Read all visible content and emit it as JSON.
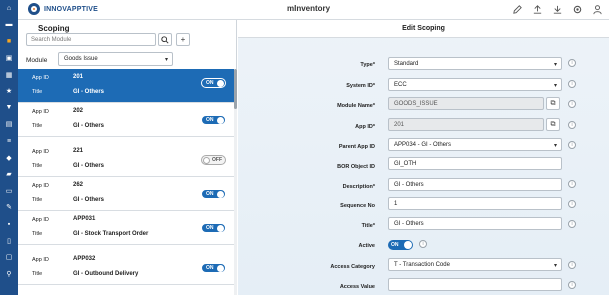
{
  "brand": {
    "name": "INNOVAPPTIVE"
  },
  "app_title": "mInventory",
  "top_icons": [
    "pencil-icon",
    "upload-icon",
    "download-icon",
    "gear-icon",
    "user-icon"
  ],
  "rail_icons": [
    "home-icon",
    "folder-icon",
    "doc-icon",
    "grid-icon",
    "star-icon",
    "filter-icon",
    "calc-icon",
    "list-icon",
    "tag-icon",
    "truck-icon",
    "inbox-icon",
    "edit-icon",
    "box-icon",
    "page-icon",
    "upload-icon",
    "monitor-icon",
    "link-icon"
  ],
  "left": {
    "title": "Scoping",
    "search_placeholder": "Search Module",
    "module_label": "Module",
    "module_value": "Goods Issue",
    "rows": [
      {
        "label1": "App ID",
        "value1": "201",
        "label2": "Title",
        "value2": "GI - Others",
        "toggle": "ON",
        "selected": true
      },
      {
        "label1": "App ID",
        "value1": "202",
        "label2": "Title",
        "value2": "GI - Others",
        "toggle": "ON",
        "selected": false
      },
      {
        "label1": "App ID",
        "value1": "221",
        "label2": "Title",
        "value2": "GI - Others",
        "toggle": "OFF",
        "selected": false
      },
      {
        "label1": "App ID",
        "value1": "262",
        "label2": "Title",
        "value2": "GI - Others",
        "toggle": "ON",
        "selected": false
      },
      {
        "label1": "App ID",
        "value1": "APP031",
        "label2": "Title",
        "value2": "GI - Stock Transport Order",
        "toggle": "ON",
        "selected": false
      },
      {
        "label1": "App ID",
        "value1": "APP032",
        "label2": "Title",
        "value2": "GI - Outbound Delivery",
        "toggle": "ON",
        "selected": false
      }
    ]
  },
  "right": {
    "header": "Edit Scoping",
    "fields": {
      "type": {
        "label": "Type*",
        "value": "Standard"
      },
      "system_id": {
        "label": "System ID*",
        "value": "ECC"
      },
      "module_name": {
        "label": "Module Name*",
        "value": "GOODS_ISSUE"
      },
      "app_id": {
        "label": "App ID*",
        "value": "201"
      },
      "parent_app_id": {
        "label": "Parent App ID",
        "value": "APP034 - GI - Others"
      },
      "bor_object_id": {
        "label": "BOR Object ID",
        "value": "GI_OTH"
      },
      "description": {
        "label": "Description*",
        "value": "GI - Others"
      },
      "sequence_no": {
        "label": "Sequence No",
        "value": "1"
      },
      "title": {
        "label": "Title*",
        "value": "GI - Others"
      },
      "active": {
        "label": "Active",
        "value": "ON"
      },
      "access_category": {
        "label": "Access Category",
        "value": "T - Transaction Code"
      },
      "access_value": {
        "label": "Access Value",
        "value": ""
      }
    }
  }
}
